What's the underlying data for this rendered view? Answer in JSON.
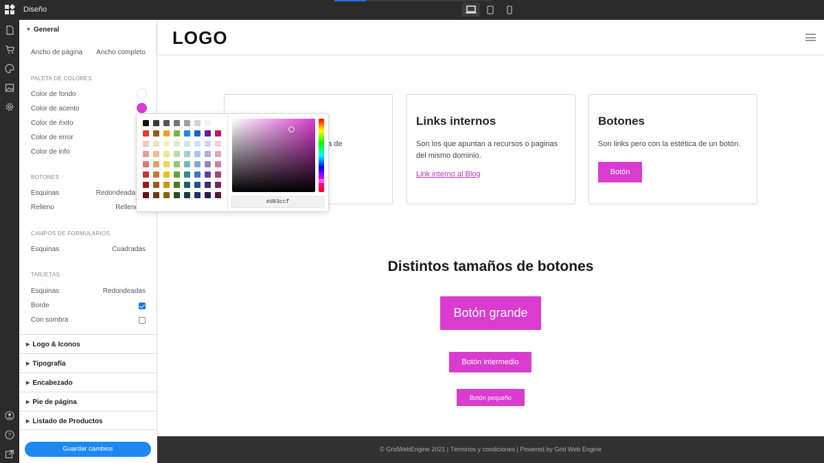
{
  "app": {
    "title": "Diseño",
    "progress_fraction": 0.2,
    "devices": [
      {
        "name": "desktop",
        "active": true
      },
      {
        "name": "tablet",
        "active": false
      },
      {
        "name": "mobile",
        "active": false
      }
    ],
    "rail_icons": [
      "pages-icon",
      "cart-icon",
      "palette-icon",
      "image-icon",
      "gear-icon"
    ],
    "rail_bottom_icons": [
      "user-icon",
      "help-icon",
      "external-link-icon"
    ]
  },
  "panel": {
    "general_label": "General",
    "page_width_label": "Ancho de página",
    "page_width_value": "Ancho completo",
    "palette_title": "PALETA DE COLORES",
    "colors": [
      {
        "label": "Color de fondo",
        "hex": "#ffffff"
      },
      {
        "label": "Color de acento",
        "hex": "#d93ccf"
      },
      {
        "label": "Color de éxito",
        "hex": ""
      },
      {
        "label": "Color de error",
        "hex": ""
      },
      {
        "label": "Color de info",
        "hex": ""
      }
    ],
    "buttons_title": "BOTONES",
    "buttons_corners_label": "Esquinas",
    "buttons_corners_value": "Redondeadas",
    "buttons_fill_label": "Relleno",
    "buttons_fill_value": "Relleno",
    "forms_title": "CAMPOS DE FORMULARIOS",
    "forms_corners_label": "Esquinas",
    "forms_corners_value": "Cuadradas",
    "cards_title": "TARJETAS",
    "cards_corners_label": "Esquinas",
    "cards_corners_value": "Redondeadas",
    "cards_border_label": "Borde",
    "cards_border_checked": true,
    "cards_shadow_label": "Con sombra",
    "cards_shadow_checked": false,
    "sections": [
      "Logo & Iconos",
      "Tipografía",
      "Encabezado",
      "Pie de página",
      "Listado de Productos"
    ],
    "save_label": "Guardar cambios"
  },
  "picker": {
    "hex_value": "#d93ccf",
    "palette_rows": [
      [
        "#111111",
        "#3a3a3a",
        "#555555",
        "#777777",
        "#a0a0a0",
        "#d4d4d4",
        "#f2f2f2",
        "#ffffff"
      ],
      [
        "#e53935",
        "#8d5a1c",
        "#f0a020",
        "#7cb342",
        "#1e88e5",
        "#1565c0",
        "#6a1b9a",
        "#c2185b"
      ],
      [
        "#f6c6c6",
        "#f3dcc2",
        "#fbefc2",
        "#dbeecf",
        "#cde5e6",
        "#cfe0f2",
        "#d9d2ee",
        "#f0cfdc"
      ],
      [
        "#ef9a9a",
        "#e9bf92",
        "#f8df8c",
        "#b9dca0",
        "#a2d0d2",
        "#a8c6ea",
        "#b8a9e0",
        "#e2a6bf"
      ],
      [
        "#e57373",
        "#dfa068",
        "#f5cf5a",
        "#94c874",
        "#6fb7b9",
        "#7fa8df",
        "#9480d0",
        "#d27ea1"
      ],
      [
        "#d32f2f",
        "#c67a2c",
        "#f2bd1c",
        "#5ea63b",
        "#2e8b8f",
        "#3a78c9",
        "#5e3fb0",
        "#b0406f"
      ],
      [
        "#a31515",
        "#9a5716",
        "#c9960a",
        "#3d7d24",
        "#1c5f66",
        "#1f4f94",
        "#3b2580",
        "#7e2550"
      ],
      [
        "#6e0f0f",
        "#6a3b0f",
        "#8a6507",
        "#265217",
        "#113d42",
        "#143463",
        "#261856",
        "#531835"
      ]
    ]
  },
  "site": {
    "logo_text": "LOGO",
    "cards": [
      {
        "title": "",
        "body": "n fuera de",
        "link": "",
        "button": ""
      },
      {
        "title": "Links internos",
        "body": "Son los que apuntan a recursos o paginas del mismo dominio.",
        "link": "Link interno al Blog",
        "button": ""
      },
      {
        "title": "Botones",
        "body": "Son links pero con la estética de un botón.",
        "link": "",
        "button": "Botón"
      }
    ],
    "sizes_title": "Distintos tamaños de botones",
    "btn_large": "Botón grande",
    "btn_medium": "Botón intermedio",
    "btn_small": "Botón pequeño",
    "accent": "#d93ccf",
    "footer": "© GridWebEngine 2021 | Términos y condiciones | Powered by Grid Web Engine"
  }
}
